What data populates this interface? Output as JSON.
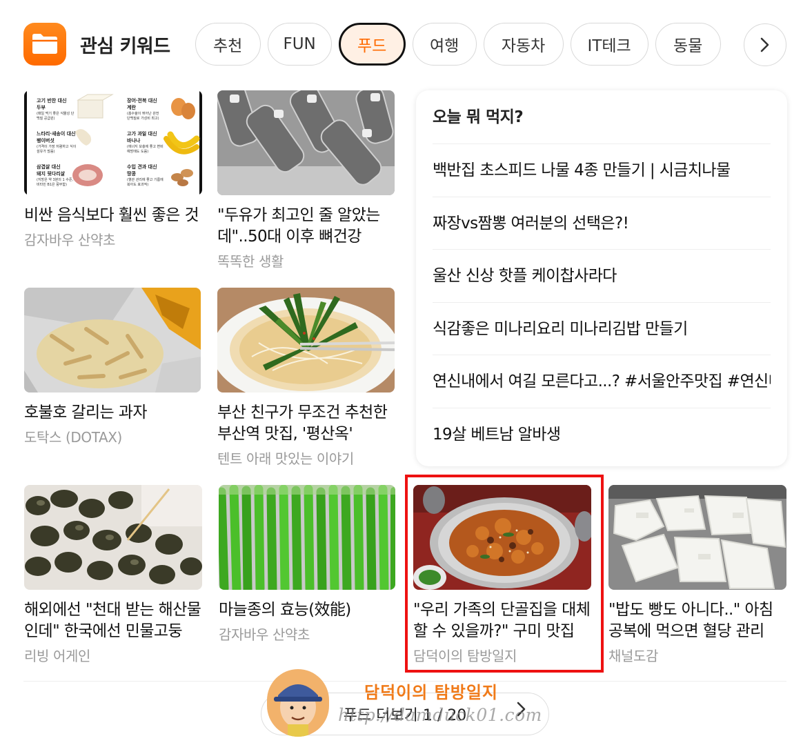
{
  "header": {
    "title": "관심 키워드",
    "tabs": [
      "추천",
      "FUN",
      "푸드",
      "여행",
      "자동차",
      "IT테크",
      "동물"
    ],
    "active_tab": "푸드"
  },
  "cards": [
    {
      "title": "비싼 음식보다 훨씬 좋은 것",
      "source": "감자바우 산약초"
    },
    {
      "title": "\"두유가 최고인 줄 알았는데\"..50대 이후 뼈건강",
      "source": "똑똑한 생활"
    },
    {
      "title": "호불호 갈리는 과자",
      "source": "도탁스 (DOTAX)"
    },
    {
      "title": "부산 친구가 무조건 추천한 부산역 맛집, '평산옥'",
      "source": "텐트 아래 맛있는 이야기"
    },
    {
      "title": "해외에선 \"천대 받는 해산물인데\" 한국에선 민물고둥",
      "source": "리빙 어게인"
    },
    {
      "title": "마늘종의 효능(效能)",
      "source": "감자바우 산약초"
    },
    {
      "title": "\"우리 가족의 단골집을 대체할 수 있을까?\" 구미 맛집",
      "source": "담덕이의 탐방일지"
    },
    {
      "title": "\"밥도 빵도 아니다..\" 아침 공복에 먹으면 혈당 관리",
      "source": "채널도감"
    }
  ],
  "thumb_text": {
    "nutrition": [
      {
        "head": "고기 반찬 대신",
        "name": "두부",
        "note": "(매일 먹기 좋은 식물성 단백질 공급원)"
      },
      {
        "head": "장어·전복 대신",
        "name": "계란",
        "note": "(흡수율이 뛰어난 완전 단백질로 가성비 최고)"
      },
      {
        "head": "느타리·새송이 대신",
        "name": "팽이버섯",
        "note": "(가격이 가장 저렴하고 식이섬유가 많음)"
      },
      {
        "head": "고가 과일 대신",
        "name": "바나나",
        "note": "(에너지 보충에 좋고 변비 예방에도 도움)"
      },
      {
        "head": "삼겹살 대신",
        "name": "돼지 뒷다리살",
        "note": "(지방은 약 3분의 1 수준, 비타민 B1은 풍부함)"
      },
      {
        "head": "수입 견과 대신",
        "name": "땅콩",
        "note": "(혈관 관리에 좋고 기름에 볶아도 효과적)"
      }
    ]
  },
  "today": {
    "title": "오늘 뭐 먹지?",
    "items": [
      "백반집 초스피드 나물 4종 만들기 | 시금치나물",
      "짜장vs짬뽕 여러분의 선택은?!",
      "울산 신상 핫플 케이찹사라다",
      "식감좋은 미나리요리 미나리김밥 만들기",
      "연신내에서 여길 모른다고...? #서울안주맛집 #연신내",
      "19살 베트남 알바생"
    ]
  },
  "footer": {
    "more_label": "푸드 더보기 1 / 20"
  },
  "watermark": {
    "name": "담덕이의 탐방일지",
    "url": "http://damduck01.com"
  },
  "colors": {
    "accent": "#ff6a00",
    "active_tab_bg": "#fff0e4",
    "highlight": "#ee1111",
    "source_text": "#9a9a9a"
  },
  "icons": {
    "keyword": "folder-icon",
    "next": "chevron-right-icon",
    "more": "chevron-right-icon"
  }
}
